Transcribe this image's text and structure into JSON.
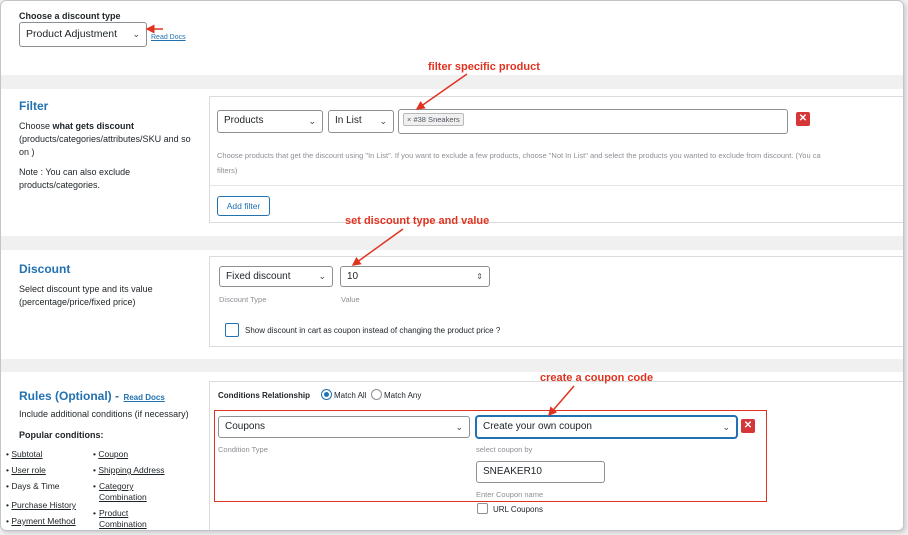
{
  "discount_type": {
    "title": "Choose a discount type",
    "selected": "Product Adjustment",
    "read_docs": "Read Docs"
  },
  "annotations": {
    "filter": "filter specific product",
    "discount": "set discount type and value",
    "coupon": "create a coupon code"
  },
  "filter": {
    "heading": "Filter",
    "desc_prefix": "Choose ",
    "desc_bold": "what gets discount",
    "desc_rest": "(products/categories/attributes/SKU and so on )",
    "note": "Note : You can also exclude products/categories.",
    "type_select": "Products",
    "operator_select": "In List",
    "tag": "× #38 Sneakers",
    "help": "Choose products that get the discount using \"In List\". If you want to exclude a few products, choose \"Not In List\" and select the products you wanted to exclude from discount. (You ca",
    "help2": "filters)",
    "add_filter": "Add filter"
  },
  "discount": {
    "heading": "Discount",
    "desc": "Select discount type and its value (percentage/price/fixed price)",
    "type_select": "Fixed discount",
    "value": "10",
    "type_label": "Discount Type",
    "value_label": "Value",
    "checkbox_label": "Show discount in cart as coupon instead of changing the product price ?"
  },
  "rules": {
    "heading": "Rules (Optional) -",
    "read_docs": "Read Docs",
    "desc": "Include additional conditions (if necessary)",
    "popular": "Popular conditions:",
    "col1": [
      "Subtotal",
      "User role",
      "Days & Time",
      "Purchase History",
      "Payment Method"
    ],
    "col2": [
      "Coupon",
      "Shipping Address",
      "Category Combination",
      "Product Combination"
    ],
    "relationship_label": "Conditions Relationship",
    "match_all": "Match All",
    "match_any": "Match Any",
    "condition_select": "Coupons",
    "condition_label": "Condition Type",
    "coupon_select": "Create your own coupon",
    "select_by_label": "select coupon by",
    "coupon_value": "SNEAKER10",
    "coupon_name_label": "Enter Coupon name",
    "url_coupons": "URL Coupons"
  },
  "colors": {
    "accent": "#2271b1",
    "annotation": "#e0331f",
    "remove": "#d63638"
  }
}
